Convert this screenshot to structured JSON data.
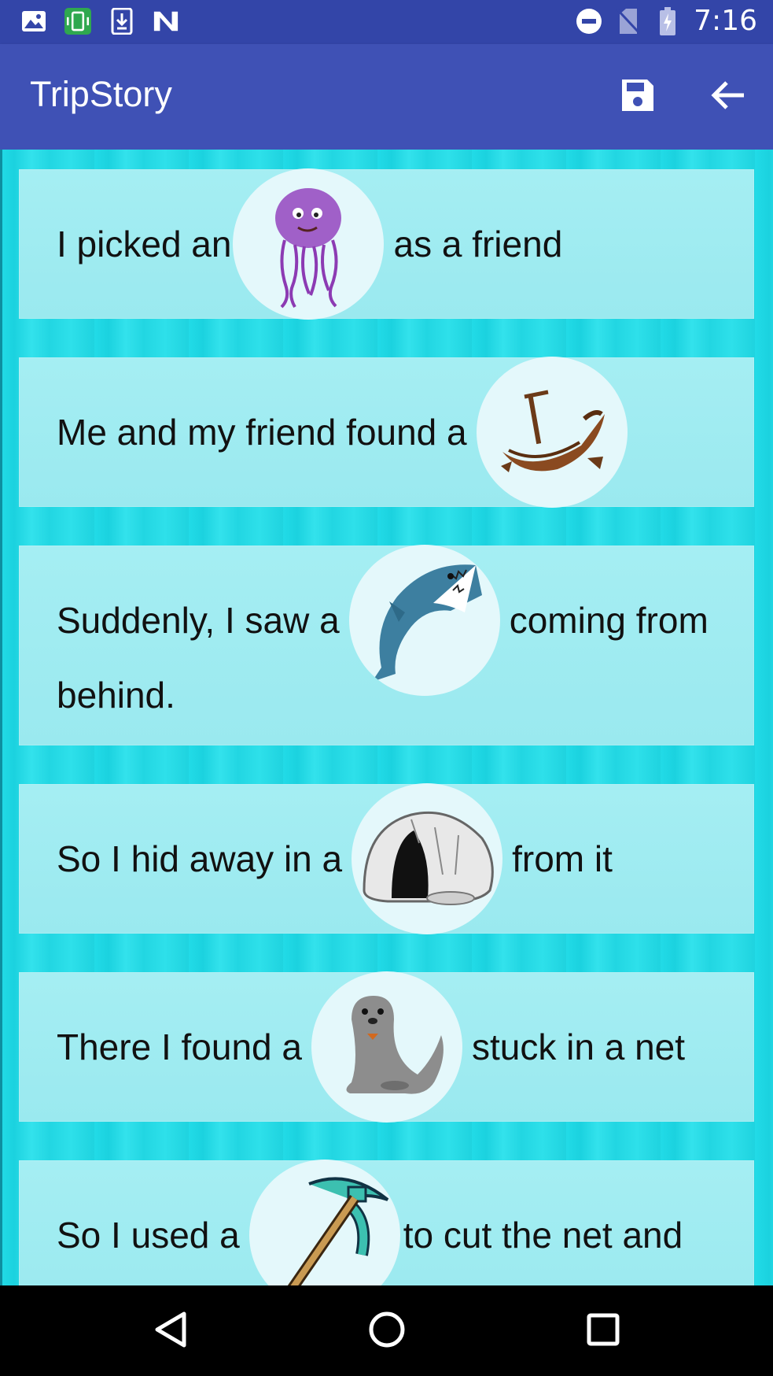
{
  "status_bar": {
    "left_icons": [
      "image-icon",
      "screen-rotation-icon",
      "download-icon",
      "n-logo-icon"
    ],
    "right_icons": [
      "do-not-disturb-icon",
      "no-sim-icon",
      "battery-charging-icon"
    ],
    "time": "7:16"
  },
  "app_bar": {
    "title": "TripStory",
    "actions": [
      "save-icon",
      "back-arrow-icon"
    ]
  },
  "story": [
    {
      "before": "I picked an",
      "picture": "jellyfish",
      "after": "as a friend",
      "line2": ""
    },
    {
      "before": "Me and my friend found a",
      "picture": "shipwreck",
      "after": "",
      "line2": ""
    },
    {
      "before": "Suddenly, I saw a",
      "picture": "shark",
      "after": "coming from",
      "line2": " behind."
    },
    {
      "before": "So I hid away in a",
      "picture": "cave",
      "after": "from it",
      "line2": ""
    },
    {
      "before": "There I found a",
      "picture": "seal",
      "after": "stuck in a net",
      "line2": ""
    },
    {
      "before": "So I used a",
      "picture": "pickaxe",
      "after": "to cut the net and",
      "line2": ""
    }
  ],
  "nav_bar": [
    "back-triangle-icon",
    "home-circle-icon",
    "recents-square-icon"
  ],
  "colors": {
    "status_bar": "#3345a8",
    "app_bar": "#3f51b5",
    "background": "#1cd9e5",
    "card": "#a5eef3"
  }
}
